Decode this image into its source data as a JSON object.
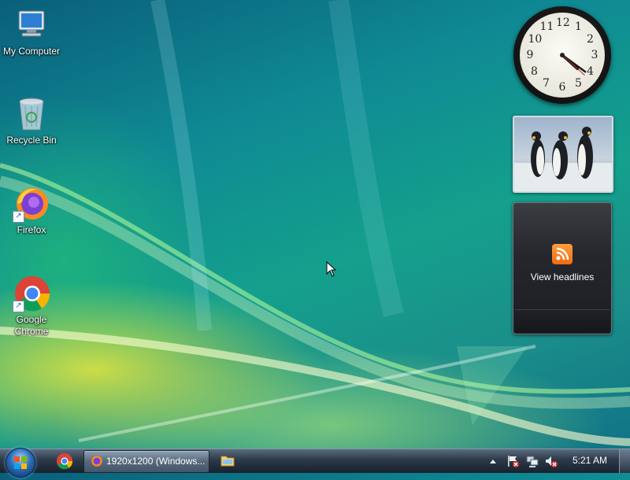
{
  "desktop": {
    "icons": [
      {
        "label": "My Computer",
        "icon": "computer-icon"
      },
      {
        "label": "Recycle Bin",
        "icon": "recycle-bin-icon"
      },
      {
        "label": "Firefox",
        "icon": "firefox-icon"
      },
      {
        "label": "Google Chrome",
        "icon": "chrome-icon"
      }
    ]
  },
  "gadgets": {
    "clock": {
      "numbers": [
        "12",
        "1",
        "2",
        "3",
        "4",
        "5",
        "6",
        "7",
        "8",
        "9",
        "10",
        "11"
      ],
      "hour": 4.4,
      "minute": 21
    },
    "slideshow": {
      "subject": "penguins-photo"
    },
    "feeds": {
      "label": "View headlines"
    }
  },
  "taskbar": {
    "start_icon": "start-orb-icon",
    "quick_launch": [
      "chrome-icon"
    ],
    "task_button": {
      "label": "1920x1200 (Windows...",
      "icon": "firefox-icon"
    },
    "pinned_folder_icon": "folder-icon",
    "tray_icons": [
      "chevron-up-icon",
      "action-center-flag-icon",
      "network-icon",
      "volume-muted-icon"
    ],
    "time": "5:21 AM"
  },
  "colors": {
    "wallpaper_teal": "#14a08c",
    "taskbar_dark": "#18222e",
    "rss_orange": "#f26a10"
  }
}
